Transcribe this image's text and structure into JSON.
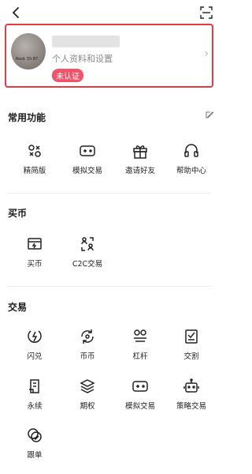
{
  "profile": {
    "subtitle": "个人资料和设置",
    "badge": "未认证",
    "avatar_caption": "Rock 'Di 87"
  },
  "sections": {
    "common": {
      "title": "常用功能",
      "items": [
        {
          "label": "精简版",
          "icon": "lite-icon"
        },
        {
          "label": "模拟交易",
          "icon": "gamepad-icon"
        },
        {
          "label": "邀请好友",
          "icon": "gift-icon"
        },
        {
          "label": "帮助中心",
          "icon": "headset-icon"
        }
      ]
    },
    "buy": {
      "title": "买币",
      "items": [
        {
          "label": "买币",
          "icon": "buy-coin-icon"
        },
        {
          "label": "C2C交易",
          "icon": "c2c-icon"
        }
      ]
    },
    "trade": {
      "title": "交易",
      "items": [
        {
          "label": "闪兑",
          "icon": "flash-icon"
        },
        {
          "label": "币币",
          "icon": "swap-icon"
        },
        {
          "label": "杠杆",
          "icon": "leverage-icon"
        },
        {
          "label": "交割",
          "icon": "delivery-icon"
        },
        {
          "label": "永续",
          "icon": "perpetual-icon"
        },
        {
          "label": "期权",
          "icon": "options-icon"
        },
        {
          "label": "模拟交易",
          "icon": "gamepad-icon"
        },
        {
          "label": "策略交易",
          "icon": "robot-icon"
        },
        {
          "label": "跟单",
          "icon": "copy-trade-icon"
        }
      ]
    }
  }
}
